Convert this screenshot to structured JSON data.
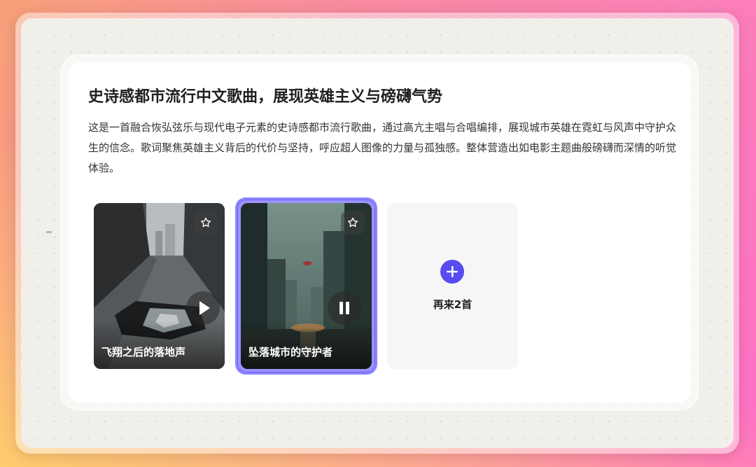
{
  "card": {
    "title": "史诗感都市流行中文歌曲，展现英雄主义与磅礴气势",
    "description": "这是一首融合恢弘弦乐与现代电子元素的史诗感都市流行歌曲，通过高亢主唱与合唱编排，展现城市英雄在霓虹与风声中守护众生的信念。歌词聚焦英雄主义背后的代价与坚持，呼应超人图像的力量与孤独感。整体营造出如电影主题曲般磅礴而深情的听觉体验。"
  },
  "songs": [
    {
      "name": "飞翔之后的落地声",
      "state": "paused",
      "icon": "play-icon",
      "selected": false
    },
    {
      "name": "坠落城市的守护者",
      "state": "playing",
      "icon": "pause-icon",
      "selected": true
    }
  ],
  "more": {
    "label": "再来2首",
    "icon": "plus-icon"
  },
  "colors": {
    "accent": "#564cf0",
    "selection": "#8e84ff"
  }
}
